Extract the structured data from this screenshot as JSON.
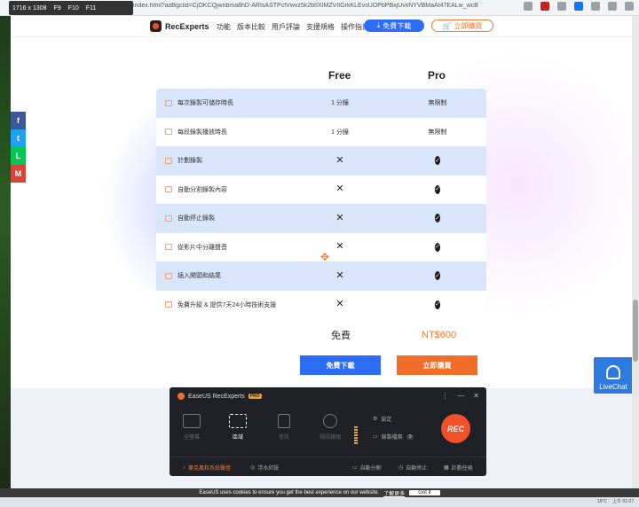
{
  "browser": {
    "dimensions": "1716 x 1308",
    "keys": [
      "F9",
      "F10",
      "F11"
    ],
    "url": "index.html?adBgclid=CjOKCQjwnbma8hD-ARIsASTPcfVwvz5k2bIIXIMZVIIGrkKLEvsUOPbPBxjUvxNYVBMaAt47EALw_wcB"
  },
  "nav": {
    "brand": "RecExperts",
    "links": [
      "功能",
      "版本比較",
      "用戶評論",
      "支援規格",
      "操作指南"
    ],
    "download_label": "免費下載",
    "buy_label": "立即購買"
  },
  "social": [
    {
      "name": "facebook",
      "glyph": "f",
      "color": "#3b5998"
    },
    {
      "name": "twitter",
      "glyph": "t",
      "color": "#1da1f2"
    },
    {
      "name": "line",
      "glyph": "L",
      "color": "#06c755"
    },
    {
      "name": "gmail",
      "glyph": "M",
      "color": "#d44638"
    }
  ],
  "table": {
    "headers": {
      "free": "Free",
      "pro": "Pro"
    },
    "rows": [
      {
        "feature": "每次錄製可儲存時長",
        "free": "1 分鐘",
        "pro": "無限制",
        "shade": true
      },
      {
        "feature": "每段錄製播放時長",
        "free": "1 分鐘",
        "pro": "無限制",
        "shade": false
      },
      {
        "feature": "計劃錄製",
        "free": "x",
        "pro": "check",
        "shade": true
      },
      {
        "feature": "自動分割錄製內容",
        "free": "x",
        "pro": "check",
        "shade": false
      },
      {
        "feature": "自動停止錄製",
        "free": "x",
        "pro": "check",
        "shade": true
      },
      {
        "feature": "從影片中分離聲音",
        "free": "x",
        "pro": "check",
        "shade": false
      },
      {
        "feature": "插入開頭和結尾",
        "free": "x",
        "pro": "check",
        "shade": true
      },
      {
        "feature": "免費升級 & 提供7天24小時技術支援",
        "free": "x",
        "pro": "check",
        "shade": false
      }
    ],
    "price_free": "免費",
    "price_pro": "NT$600",
    "download_label": "免費下載",
    "buy_label": "立即購買"
  },
  "livechat": {
    "label": "LiveChat"
  },
  "recorder": {
    "title": "EaseUS RecExperts",
    "badge": "PRO",
    "modes": [
      {
        "label": "全螢幕",
        "active": false
      },
      {
        "label": "區域",
        "active": true
      },
      {
        "label": "音訊",
        "active": false
      },
      {
        "label": "視訊鏡頭",
        "active": false
      }
    ],
    "settings_label": "設定",
    "files_label": "錄製檔案",
    "files_count": "9",
    "rec_label": "REC",
    "bottom": {
      "sound": "麥克風和系統聲音",
      "watch": "浮水印設",
      "split": "自動分割",
      "stop": "自動停止",
      "schedule": "計劃任務"
    }
  },
  "cookie": {
    "text": "EaseUS uses cookies to ensure you get the best experience on our website.",
    "learn": "了解更多",
    "gotit": "Got it"
  },
  "taskbar": {
    "weather": "18°C",
    "time": "上午 01:07"
  }
}
